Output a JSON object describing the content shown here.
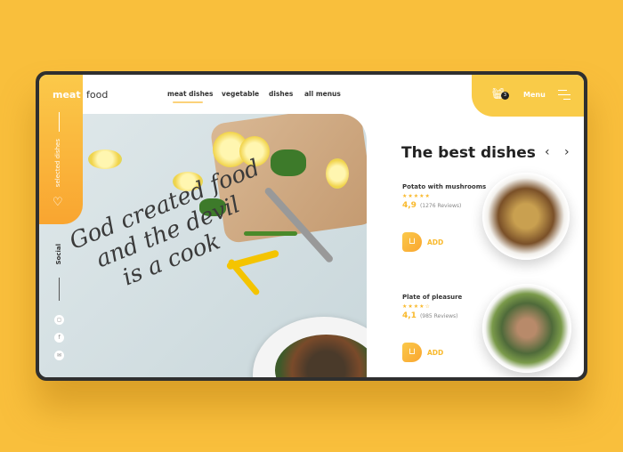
{
  "brand": {
    "part1": "meat",
    "part2": "food"
  },
  "nav": {
    "items": [
      "meat dishes",
      "vegetable",
      "dishes",
      "all menus"
    ],
    "active": 0
  },
  "header": {
    "cart_count": "3",
    "menu_label": "Menu"
  },
  "sidebar": {
    "label": "selected dishes",
    "social_label": "Social",
    "social_icons": [
      "instagram-icon",
      "facebook-icon",
      "mail-icon"
    ]
  },
  "hero": {
    "quote_lines": [
      "God created food",
      "and the devil",
      "is a cook"
    ]
  },
  "section": {
    "title": "The best dishes"
  },
  "dishes": [
    {
      "name": "Potato with mushrooms",
      "stars": "★★★★★",
      "rating": "4,9",
      "reviews": "(1276 Reviews)",
      "add": "ADD"
    },
    {
      "name": "Plate of pleasure",
      "stars": "★★★★☆",
      "rating": "4,1",
      "reviews": "(985 Reviews)",
      "add": "ADD"
    }
  ],
  "colors": {
    "accent": "#F9B92C",
    "background": "#F9BF3C"
  }
}
